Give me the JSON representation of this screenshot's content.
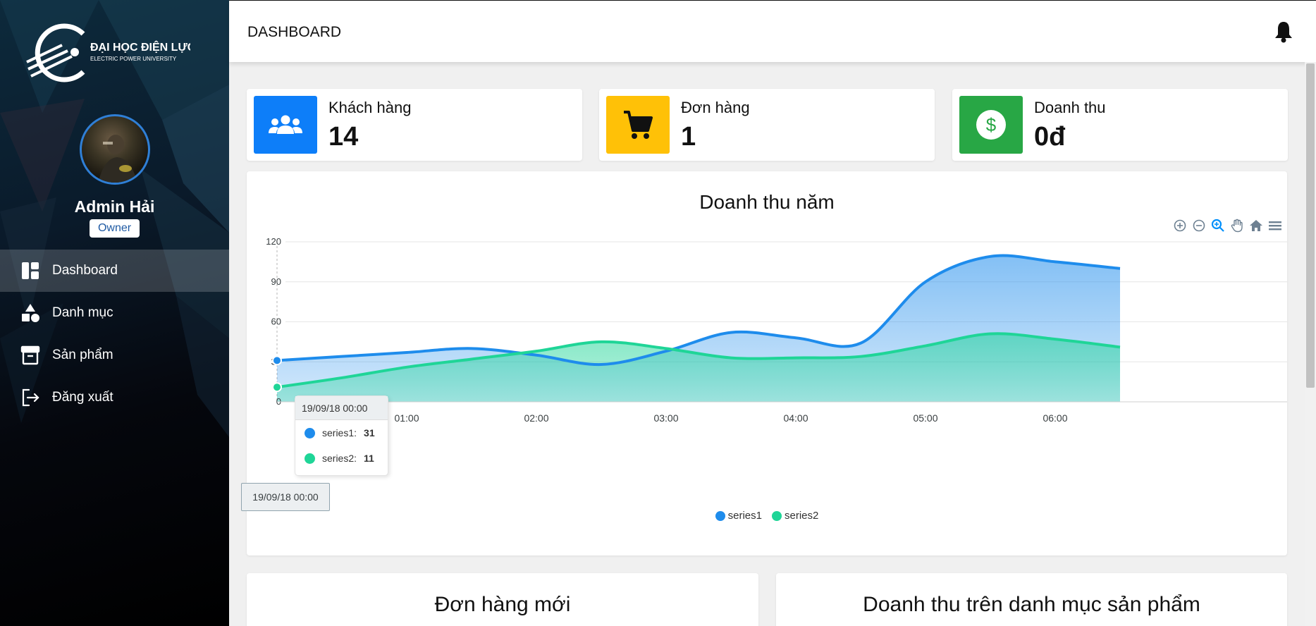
{
  "brand": {
    "name": "ĐẠI HỌC ĐIỆN LỰC",
    "subtitle": "ELECTRIC POWER UNIVERSITY"
  },
  "user": {
    "name": "Admin Hải",
    "role": "Owner"
  },
  "sidebar": {
    "items": [
      {
        "label": "Dashboard",
        "icon": "dashboard-icon",
        "active": true
      },
      {
        "label": "Danh mục",
        "icon": "shapes-icon",
        "active": false
      },
      {
        "label": "Sản phẩm",
        "icon": "archive-box-icon",
        "active": false
      },
      {
        "label": "Đăng xuất",
        "icon": "logout-icon",
        "active": false
      }
    ]
  },
  "header": {
    "title": "DASHBOARD",
    "notification_icon": "bell-icon"
  },
  "stats": [
    {
      "label": "Khách hàng",
      "value": "14",
      "color": "#0d7ef9",
      "icon": "users-icon"
    },
    {
      "label": "Đơn hàng",
      "value": "1",
      "color": "#ffc107",
      "icon": "cart-icon"
    },
    {
      "label": "Doanh thu",
      "value": "0đ",
      "color": "#28a745",
      "icon": "dollar-icon"
    }
  ],
  "chart": {
    "title": "Doanh thu năm",
    "toolbar": [
      "zoom-in-icon",
      "zoom-out-icon",
      "selection-zoom-icon",
      "pan-hand-icon",
      "reset-home-icon",
      "menu-icon"
    ],
    "tooltip": {
      "header": "19/09/18 00:00",
      "rows": [
        {
          "name": "series1",
          "value": "31"
        },
        {
          "name": "series2",
          "value": "11"
        }
      ]
    },
    "x_tooltip": "19/09/18 00:00"
  },
  "chart_data": {
    "type": "area",
    "title": "Doanh thu năm",
    "x": [
      "00:00",
      "00:30",
      "01:00",
      "01:30",
      "02:00",
      "02:30",
      "03:00",
      "03:30",
      "04:00",
      "04:30",
      "05:00",
      "05:30",
      "06:00",
      "06:30"
    ],
    "x_tick_labels": [
      "01:00",
      "02:00",
      "03:00",
      "04:00",
      "05:00",
      "06:00"
    ],
    "y_ticks": [
      0,
      30,
      60,
      90,
      120
    ],
    "ylim": [
      0,
      120
    ],
    "grid": true,
    "legend_position": "bottom",
    "series": [
      {
        "name": "series1",
        "color": "#1e8cec",
        "values": [
          31,
          34,
          37,
          40,
          35,
          28,
          38,
          52,
          48,
          44,
          90,
          109,
          105,
          100
        ]
      },
      {
        "name": "series2",
        "color": "#1fd597",
        "values": [
          11,
          18,
          26,
          32,
          38,
          45,
          40,
          33,
          33,
          34,
          42,
          51,
          47,
          41
        ]
      }
    ]
  },
  "bottom_cards": [
    {
      "title": "Đơn hàng mới"
    },
    {
      "title": "Doanh thu trên danh mục sản phẩm"
    }
  ]
}
